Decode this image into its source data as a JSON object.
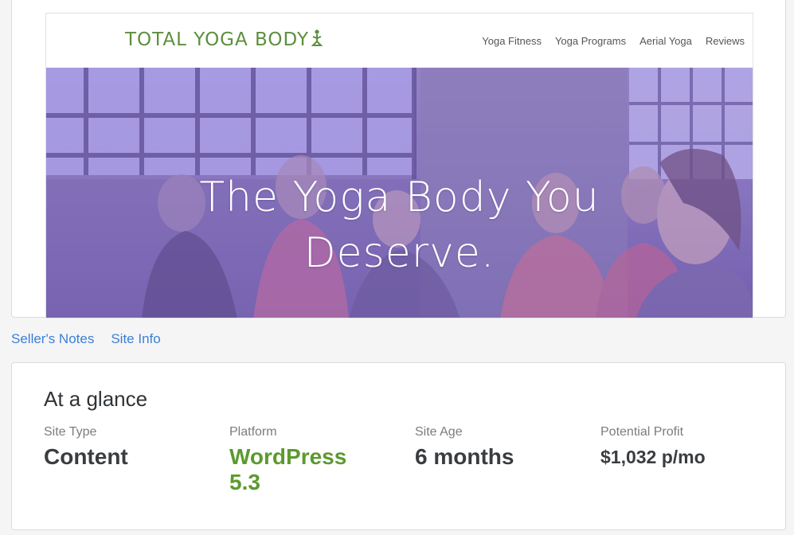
{
  "preview": {
    "logo": "TOTAL YOGA BODY",
    "nav": [
      "Yoga Fitness",
      "Yoga Programs",
      "Aerial Yoga",
      "Reviews"
    ],
    "hero_line1": "The Yoga Body You",
    "hero_line2": "Deserve."
  },
  "tabs": [
    "Seller's Notes",
    "Site Info"
  ],
  "glance": {
    "title": "At a glance",
    "stats": [
      {
        "label": "Site Type",
        "value": "Content"
      },
      {
        "label": "Platform",
        "value": "WordPress 5.3"
      },
      {
        "label": "Site Age",
        "value": "6 months"
      },
      {
        "label": "Potential Profit",
        "value": "$1,032 p/mo"
      }
    ]
  },
  "colors": {
    "link": "#3b7fd6",
    "accent_green": "#5c9a2f",
    "logo_green": "#5c8f3c",
    "hero_overlay": "#8a78bb"
  }
}
